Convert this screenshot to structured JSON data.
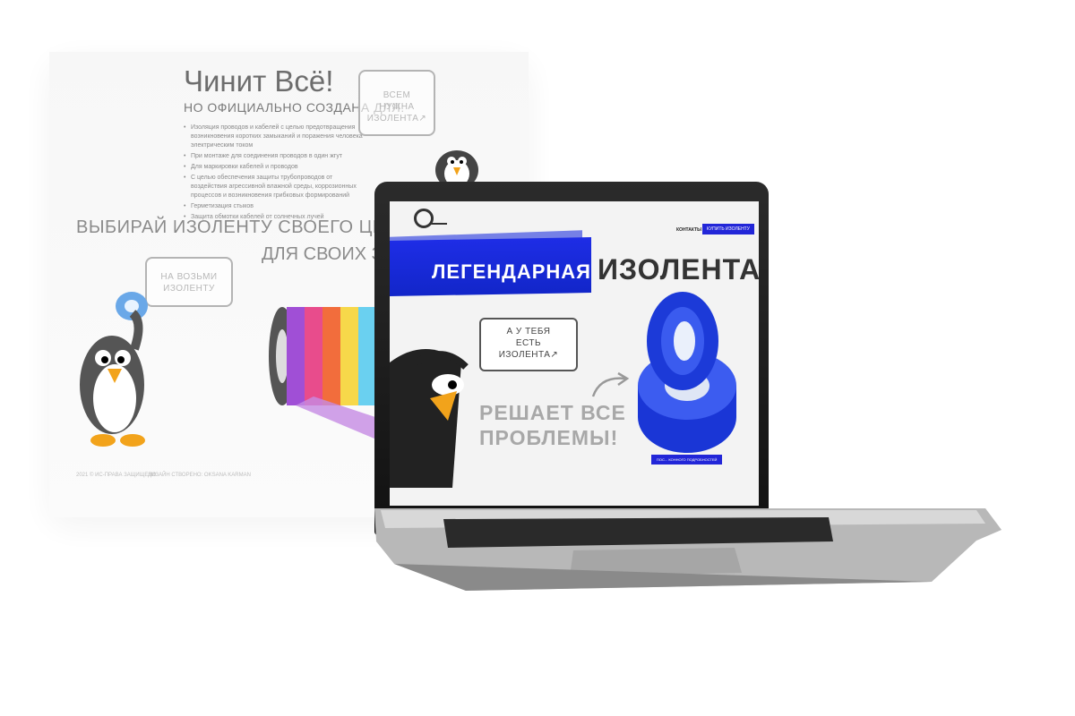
{
  "background_page": {
    "title": "Чинит Всё!",
    "subtitle": "НО ОФИЦИАЛЬНО СОЗДАНА ДЛЯ:",
    "list": [
      "Изоляция проводов и кабелей с целью предотвращения возникновения коротких замыканий и поражения человека электрическим током",
      "При монтаже для соединения проводов в один жгут",
      "Для маркировки кабелей и проводов",
      "С целью обеспечения защиты трубопроводов от воздействия агрессивной влажной среды, коррозионных процессов и возникновения грибковых формирований",
      "Герметизация стыков",
      "Защита обмотки кабелей от солнечных лучей"
    ],
    "bubble_top": [
      "ВСЕМ",
      "НУЖНА",
      "ИЗОЛЕНТА↗"
    ],
    "choose_line1": "ВЫБИРАЙ ИЗОЛЕНТУ СВОЕГО ЦВЕТА",
    "choose_line2": "ДЛЯ СВОИХ ЗАДАЧ",
    "bubble_left": [
      "НА ВОЗЬМИ",
      "ИЗОЛЕНТУ"
    ],
    "footer_a": "2021 © ИС-ПРАВА ЗАЩИЩЕНО",
    "footer_b": "ДИЗАЙН СТВОРЕНО: OKSANA KARMAN"
  },
  "screen": {
    "nav": {
      "contacts": "КОНТАКТЫ",
      "buy": "КУПИТЬ ИЗОЛЕНТУ"
    },
    "hero_title_a": "ЛЕГЕНДАРНАЯ",
    "hero_title_b": "ИЗОЛЕНТА",
    "bubble": [
      "А У ТЕБЯ",
      "ЕСТЬ",
      "ИЗОЛЕНТА↗"
    ],
    "solves_line1": "РЕШАЕТ ВСЕ",
    "solves_line2": "ПРОБЛЕМЫ!",
    "more_button": "ПОС... КОННОГО ПОДРОБНОСТЕЙ"
  },
  "colors": {
    "accent_blue": "#2226d8",
    "stripes": [
      "#a04fd6",
      "#e84c8c",
      "#f26d3c",
      "#f7d84a",
      "#6ad0f0"
    ]
  },
  "icons": [
    "penguin-mascot",
    "tape-roll",
    "arrow-icon",
    "logo-icon"
  ]
}
